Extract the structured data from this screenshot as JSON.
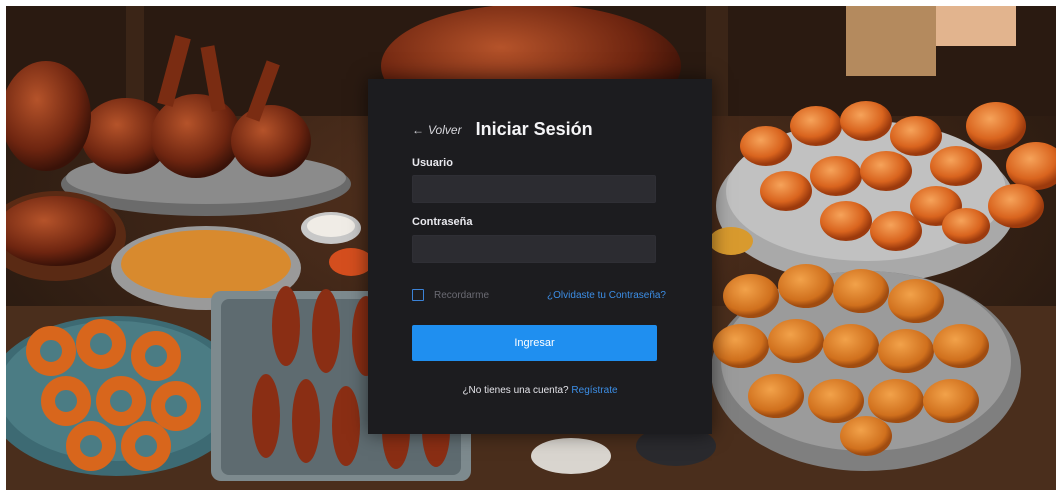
{
  "login": {
    "back_label": "Volver",
    "title": "Iniciar Sesión",
    "username_label": "Usuario",
    "username_value": "",
    "password_label": "Contraseña",
    "password_value": "",
    "remember_label": "Recordarme",
    "forgot_label": "¿Olvidaste tu Contraseña?",
    "submit_label": "Ingresar",
    "signup_prompt": "¿No tienes una cuenta?",
    "signup_link": "Regístrate"
  },
  "icons": {
    "back": "arrow-left-icon",
    "remember": "checkbox-icon"
  },
  "colors": {
    "panel": "#1c1c1f",
    "input": "#2c2c31",
    "accent": "#1f8ff0",
    "link": "#3c8ee6"
  }
}
